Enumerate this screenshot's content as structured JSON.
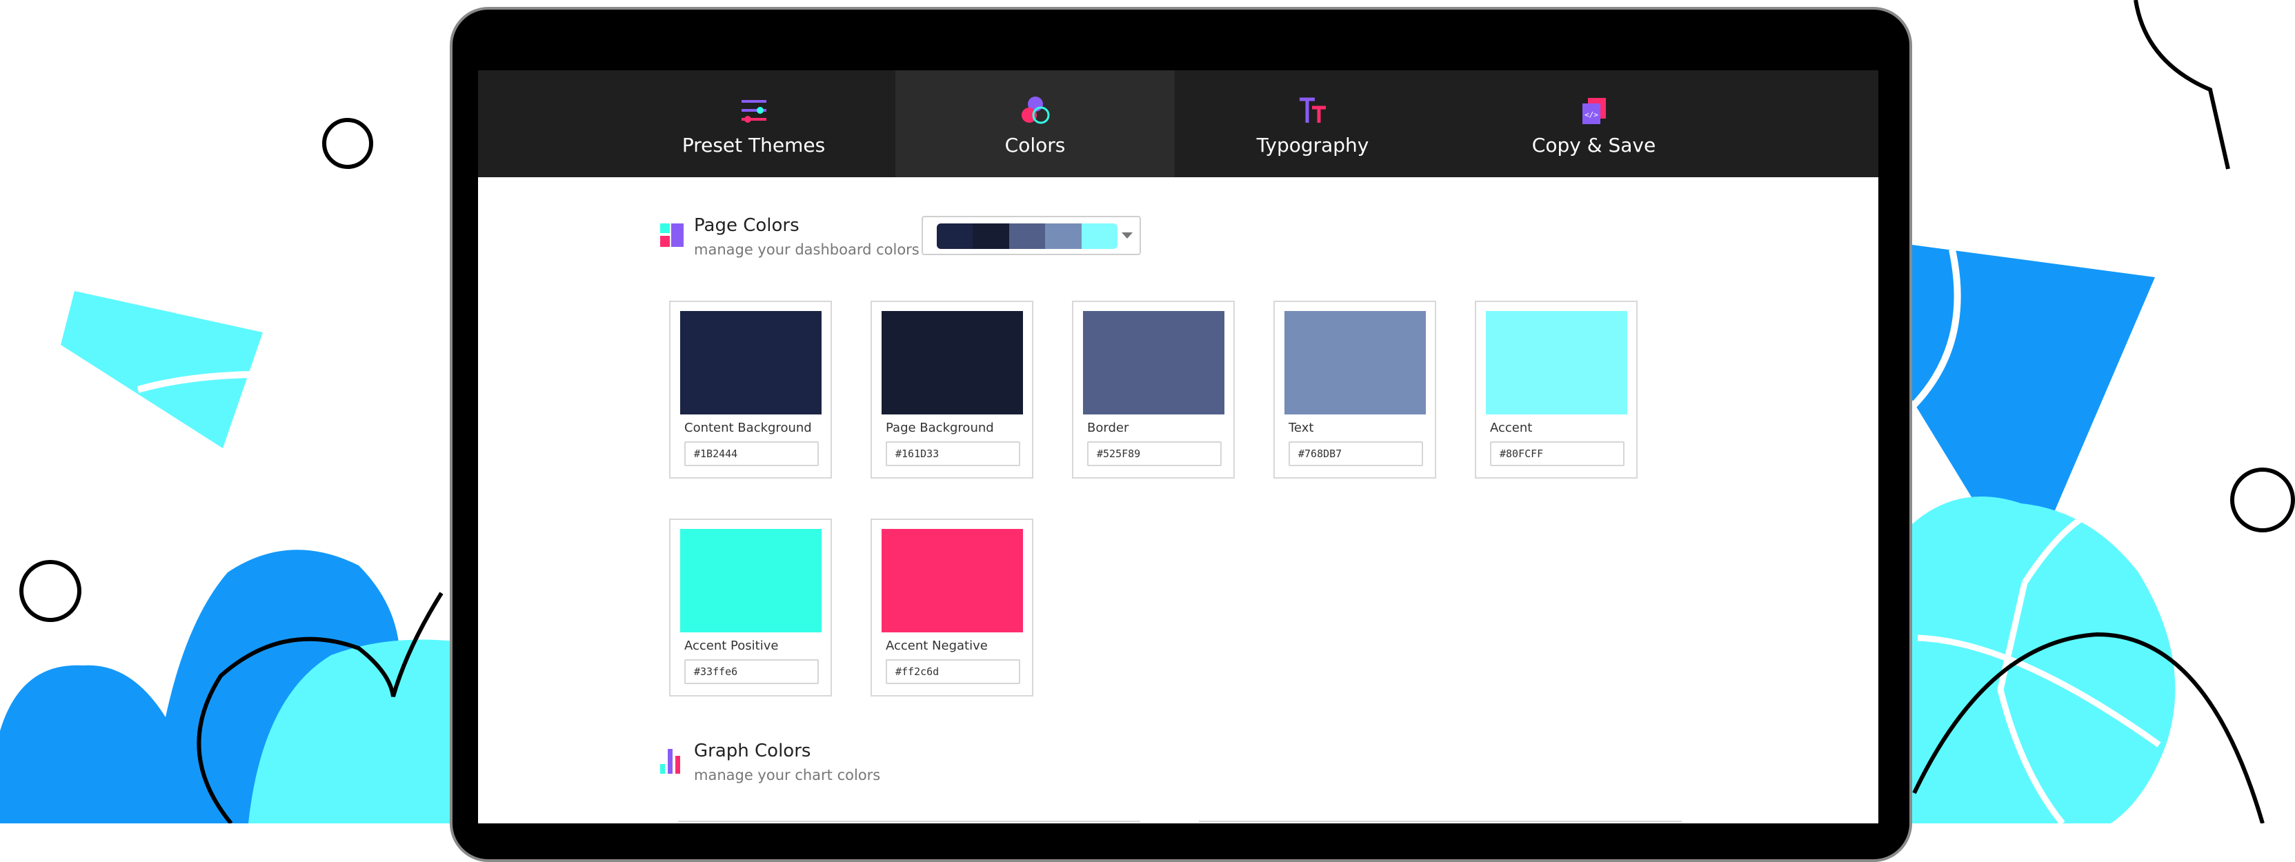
{
  "tabs": [
    {
      "label": "Preset Themes",
      "icon": "sliders-icon",
      "active": false
    },
    {
      "label": "Colors",
      "icon": "color-circles-icon",
      "active": true
    },
    {
      "label": "Typography",
      "icon": "text-tt-icon",
      "active": false
    },
    {
      "label": "Copy & Save",
      "icon": "code-copy-icon",
      "active": false
    }
  ],
  "page_colors": {
    "title": "Page Colors",
    "subtitle": "manage your dashboard colors",
    "palette": [
      "#1B2444",
      "#161D33",
      "#525F89",
      "#768DB7",
      "#80FCFF"
    ],
    "cards": [
      {
        "name": "Content Background",
        "hex": "#1B2444",
        "color": "#1B2444"
      },
      {
        "name": "Page Background",
        "hex": "#161D33",
        "color": "#161D33"
      },
      {
        "name": "Border",
        "hex": "#525F89",
        "color": "#525F89"
      },
      {
        "name": "Text",
        "hex": "#768DB7",
        "color": "#768DB7"
      },
      {
        "name": "Accent",
        "hex": "#80FCFF",
        "color": "#80FCFF"
      },
      {
        "name": "Accent Positive",
        "hex": "#33ffe6",
        "color": "#33ffe6"
      },
      {
        "name": "Accent Negative",
        "hex": "#ff2c6d",
        "color": "#ff2c6d"
      }
    ]
  },
  "graph_colors": {
    "title": "Graph Colors",
    "subtitle": "manage your chart colors"
  },
  "theme": {
    "tab_bar": "#1f1f1f",
    "tab_active": "#2c2c2c",
    "deco_blue": "#1398fa",
    "deco_cyan": "#5df9ff"
  }
}
